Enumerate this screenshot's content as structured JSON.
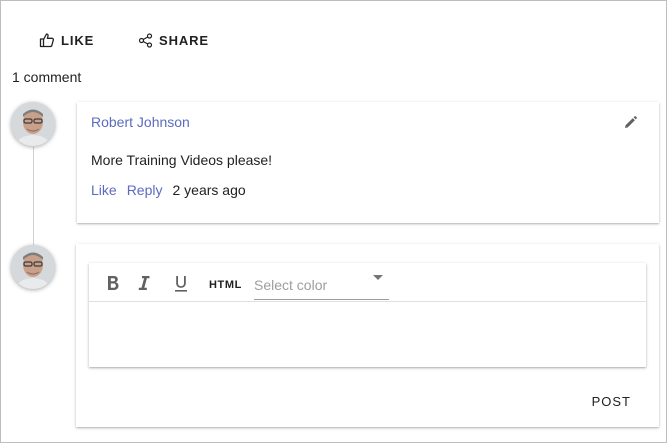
{
  "actions": {
    "like_label": "LIKE",
    "share_label": "SHARE"
  },
  "comments_count": "1 comment",
  "comment": {
    "author": "Robert Johnson",
    "text": "More Training Videos please!",
    "like_label": "Like",
    "reply_label": "Reply",
    "time": "2 years ago"
  },
  "reply_box": {
    "toolbar": {
      "bold_icon": "bold-icon",
      "italic_icon": "italic-icon",
      "underline_icon": "underline-icon",
      "html_label": "HTML",
      "color_placeholder": "Select color"
    },
    "post_label": "POST"
  },
  "colors": {
    "accent": "#5c6bc0",
    "text": "#212121",
    "muted": "#9e9e9e"
  }
}
